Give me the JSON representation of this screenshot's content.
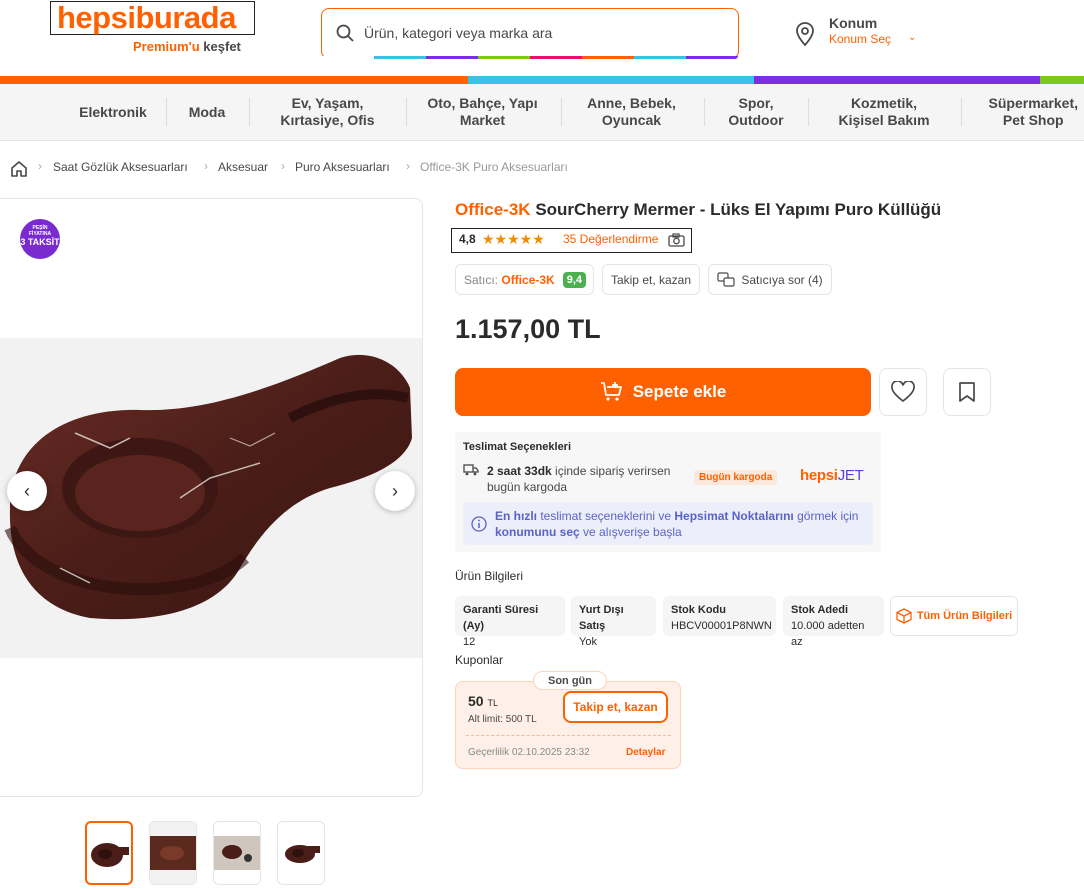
{
  "header": {
    "logo_text": "hepsiburada",
    "premium_prefix": "Premium'u",
    "premium_suffix": "keşfet",
    "search_placeholder": "Ürün, kategori veya marka ara",
    "location_title": "Konum",
    "location_sub": "Konum Seç"
  },
  "colors": {
    "brand": "#ff6000",
    "bar": [
      "#ff6000",
      "#3ac1e8",
      "#7b2fe0",
      "#7ac81e"
    ]
  },
  "categories": [
    "Elektronik",
    "Moda",
    "Ev, Yaşam,\nKırtasiye, Ofis",
    "Oto, Bahçe, Yapı\nMarket",
    "Anne, Bebek,\nOyuncak",
    "Spor,\nOutdoor",
    "Kozmetik,\nKişisel Bakım",
    "Süpermarket,\nPet Shop"
  ],
  "breadcrumb": [
    "Saat Gözlük Aksesuarları",
    "Aksesuar",
    "Puro Aksesuarları",
    "Office-3K Puro Aksesuarları"
  ],
  "badge": {
    "line1": "PEŞİN",
    "line2": "FİYATINA",
    "line3": "3 TAKSİT"
  },
  "product": {
    "brand": "Office-3K",
    "title": "SourCherry Mermer - Lüks El Yapımı Puro Küllüğü",
    "rating": "4,8",
    "stars": 4.8,
    "reviews": "35 Değerlendirme",
    "seller_label": "Satıcı:",
    "seller_name": "Office-3K",
    "seller_score": "9,4",
    "follow_label": "Takip et, kazan",
    "ask_label": "Satıcıya sor (4)",
    "price": "1.157,00 TL",
    "cart_label": "Sepete ekle"
  },
  "delivery": {
    "title": "Teslimat Seçenekleri",
    "time_bold": "2 saat 33dk",
    "time_rest": " içinde sipariş verirsen",
    "line2": "bugün kargoda",
    "badge": "Bugün kargoda",
    "carrier_a": "hepsi",
    "carrier_b": "JET",
    "info_bold1": "En hızlı",
    "info_t1": " teslimat seçeneklerini ve ",
    "info_bold2": "Hepsimat Noktalarını",
    "info_t2": " görmek için",
    "info_bold3": "konumunu seç",
    "info_t3": " ve alışverişe başla"
  },
  "specs": {
    "title": "Ürün Bilgileri",
    "items": [
      {
        "label": "Garanti Süresi (Ay)",
        "value": "12"
      },
      {
        "label": "Yurt Dışı Satış",
        "value": "Yok"
      },
      {
        "label": "Stok Kodu",
        "value": "HBCV00001P8NWN"
      },
      {
        "label": "Stok Adedi",
        "value": "10.000 adetten az"
      }
    ],
    "all_label": "Tüm Ürün Bilgileri"
  },
  "coupon": {
    "title": "Kuponlar",
    "last_day": "Son gün",
    "amount": "50",
    "currency": "TL",
    "limit": "Alt limit: 500 TL",
    "button": "Takip et, kazan",
    "validity": "Geçerlilik 02.10.2025 23:32",
    "details": "Detaylar"
  }
}
